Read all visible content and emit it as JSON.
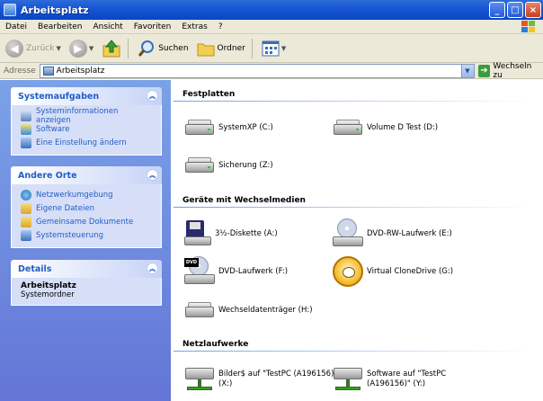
{
  "window": {
    "title": "Arbeitsplatz"
  },
  "menu": [
    "Datei",
    "Bearbeiten",
    "Ansicht",
    "Favoriten",
    "Extras",
    "?"
  ],
  "toolbar": {
    "back_label": "Zurück",
    "search_label": "Suchen",
    "folders_label": "Ordner"
  },
  "address": {
    "label": "Adresse",
    "value": "Arbeitsplatz",
    "go_label": "Wechseln zu"
  },
  "sidebar": {
    "system_tasks": {
      "title": "Systemaufgaben",
      "items": [
        "Systeminformationen anzeigen",
        "Software",
        "Eine Einstellung ändern"
      ]
    },
    "other_places": {
      "title": "Andere Orte",
      "items": [
        "Netzwerkumgebung",
        "Eigene Dateien",
        "Gemeinsame Dokumente",
        "Systemsteuerung"
      ]
    },
    "details": {
      "title": "Details",
      "name": "Arbeitsplatz",
      "type": "Systemordner"
    }
  },
  "content": {
    "groups": {
      "hard_disks": "Festplatten",
      "removable": "Geräte mit Wechselmedien",
      "network": "Netzlaufwerke"
    },
    "hard_disks": [
      "SystemXP (C:)",
      "Volume D Test (D:)",
      "Sicherung (Z:)"
    ],
    "removable": [
      "3½-Diskette (A:)",
      "DVD-RW-Laufwerk (E:)",
      "DVD-Laufwerk (F:)",
      "Virtual CloneDrive (G:)",
      "Wechseldatenträger (H:)"
    ],
    "network": [
      {
        "line1": "Bilder$ auf \"TestPC (A196156)\"",
        "line2": "(X:)"
      },
      {
        "line1": "Software auf \"TestPC",
        "line2": "(A196156)\" (Y:)"
      }
    ],
    "dvd_badge": "DVD"
  },
  "colors": {
    "titlebar": "#0a46c4",
    "sidebar_gradient_top": "#7ba2e7",
    "sidebar_link": "#215dc6"
  }
}
